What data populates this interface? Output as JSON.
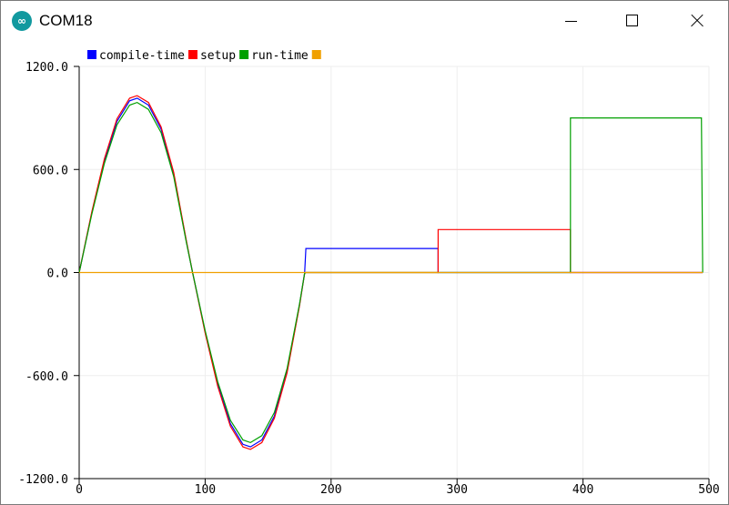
{
  "window": {
    "title": "COM18",
    "icon": "arduino-infinity-icon",
    "icon_glyph": "∞",
    "icon_color": "#12999f",
    "controls": [
      "minimize-icon",
      "maximize-icon",
      "close-icon"
    ]
  },
  "chart_data": {
    "type": "line",
    "title": "",
    "xlabel": "",
    "ylabel": "",
    "xlim": [
      0,
      500
    ],
    "ylim": [
      -1200,
      1200
    ],
    "y_ticks": [
      -1200,
      -600,
      0,
      600,
      1200
    ],
    "y_tick_labels": [
      "-1200.0",
      "-600.0",
      "0.0",
      "600.0",
      "1200.0"
    ],
    "x_ticks": [
      0,
      100,
      200,
      300,
      400,
      500
    ],
    "x_tick_labels": [
      "0",
      "100",
      "200",
      "300",
      "400",
      "500"
    ],
    "grid": true,
    "legend_position": "top-left",
    "series": [
      {
        "name": "compile-time",
        "color": "#0000ff",
        "points": [
          [
            0,
            0
          ],
          [
            10,
            345
          ],
          [
            20,
            650
          ],
          [
            30,
            880
          ],
          [
            40,
            1000
          ],
          [
            46,
            1015
          ],
          [
            55,
            975
          ],
          [
            65,
            835
          ],
          [
            75,
            575
          ],
          [
            85,
            185
          ],
          [
            90,
            0
          ],
          [
            100,
            -345
          ],
          [
            110,
            -650
          ],
          [
            120,
            -880
          ],
          [
            130,
            -1000
          ],
          [
            136,
            -1015
          ],
          [
            145,
            -975
          ],
          [
            155,
            -835
          ],
          [
            165,
            -575
          ],
          [
            175,
            -185
          ],
          [
            179,
            -5
          ],
          [
            180,
            140
          ],
          [
            285,
            140
          ],
          [
            285,
            0
          ],
          [
            495,
            0
          ]
        ]
      },
      {
        "name": "setup",
        "color": "#ff0000",
        "points": [
          [
            0,
            0
          ],
          [
            10,
            352
          ],
          [
            20,
            662
          ],
          [
            30,
            895
          ],
          [
            40,
            1015
          ],
          [
            46,
            1030
          ],
          [
            55,
            990
          ],
          [
            65,
            848
          ],
          [
            75,
            585
          ],
          [
            85,
            190
          ],
          [
            90,
            0
          ],
          [
            100,
            -352
          ],
          [
            110,
            -662
          ],
          [
            120,
            -895
          ],
          [
            130,
            -1015
          ],
          [
            136,
            -1030
          ],
          [
            145,
            -990
          ],
          [
            155,
            -848
          ],
          [
            165,
            -585
          ],
          [
            175,
            -190
          ],
          [
            179,
            -5
          ],
          [
            180,
            0
          ],
          [
            285,
            0
          ],
          [
            285,
            250
          ],
          [
            390,
            250
          ],
          [
            390,
            0
          ],
          [
            495,
            0
          ]
        ]
      },
      {
        "name": "run-time",
        "color": "#00a000",
        "points": [
          [
            0,
            0
          ],
          [
            10,
            338
          ],
          [
            20,
            635
          ],
          [
            30,
            860
          ],
          [
            40,
            975
          ],
          [
            46,
            990
          ],
          [
            55,
            950
          ],
          [
            65,
            815
          ],
          [
            75,
            560
          ],
          [
            85,
            180
          ],
          [
            90,
            0
          ],
          [
            100,
            -338
          ],
          [
            110,
            -635
          ],
          [
            120,
            -860
          ],
          [
            130,
            -975
          ],
          [
            136,
            -990
          ],
          [
            145,
            -950
          ],
          [
            155,
            -815
          ],
          [
            165,
            -560
          ],
          [
            175,
            -180
          ],
          [
            179,
            -5
          ],
          [
            180,
            0
          ],
          [
            390,
            0
          ],
          [
            390,
            900
          ],
          [
            494,
            900
          ],
          [
            495,
            0
          ]
        ]
      },
      {
        "name": "",
        "color": "#f0a000",
        "points": [
          [
            0,
            0
          ],
          [
            495,
            0
          ]
        ]
      }
    ]
  }
}
